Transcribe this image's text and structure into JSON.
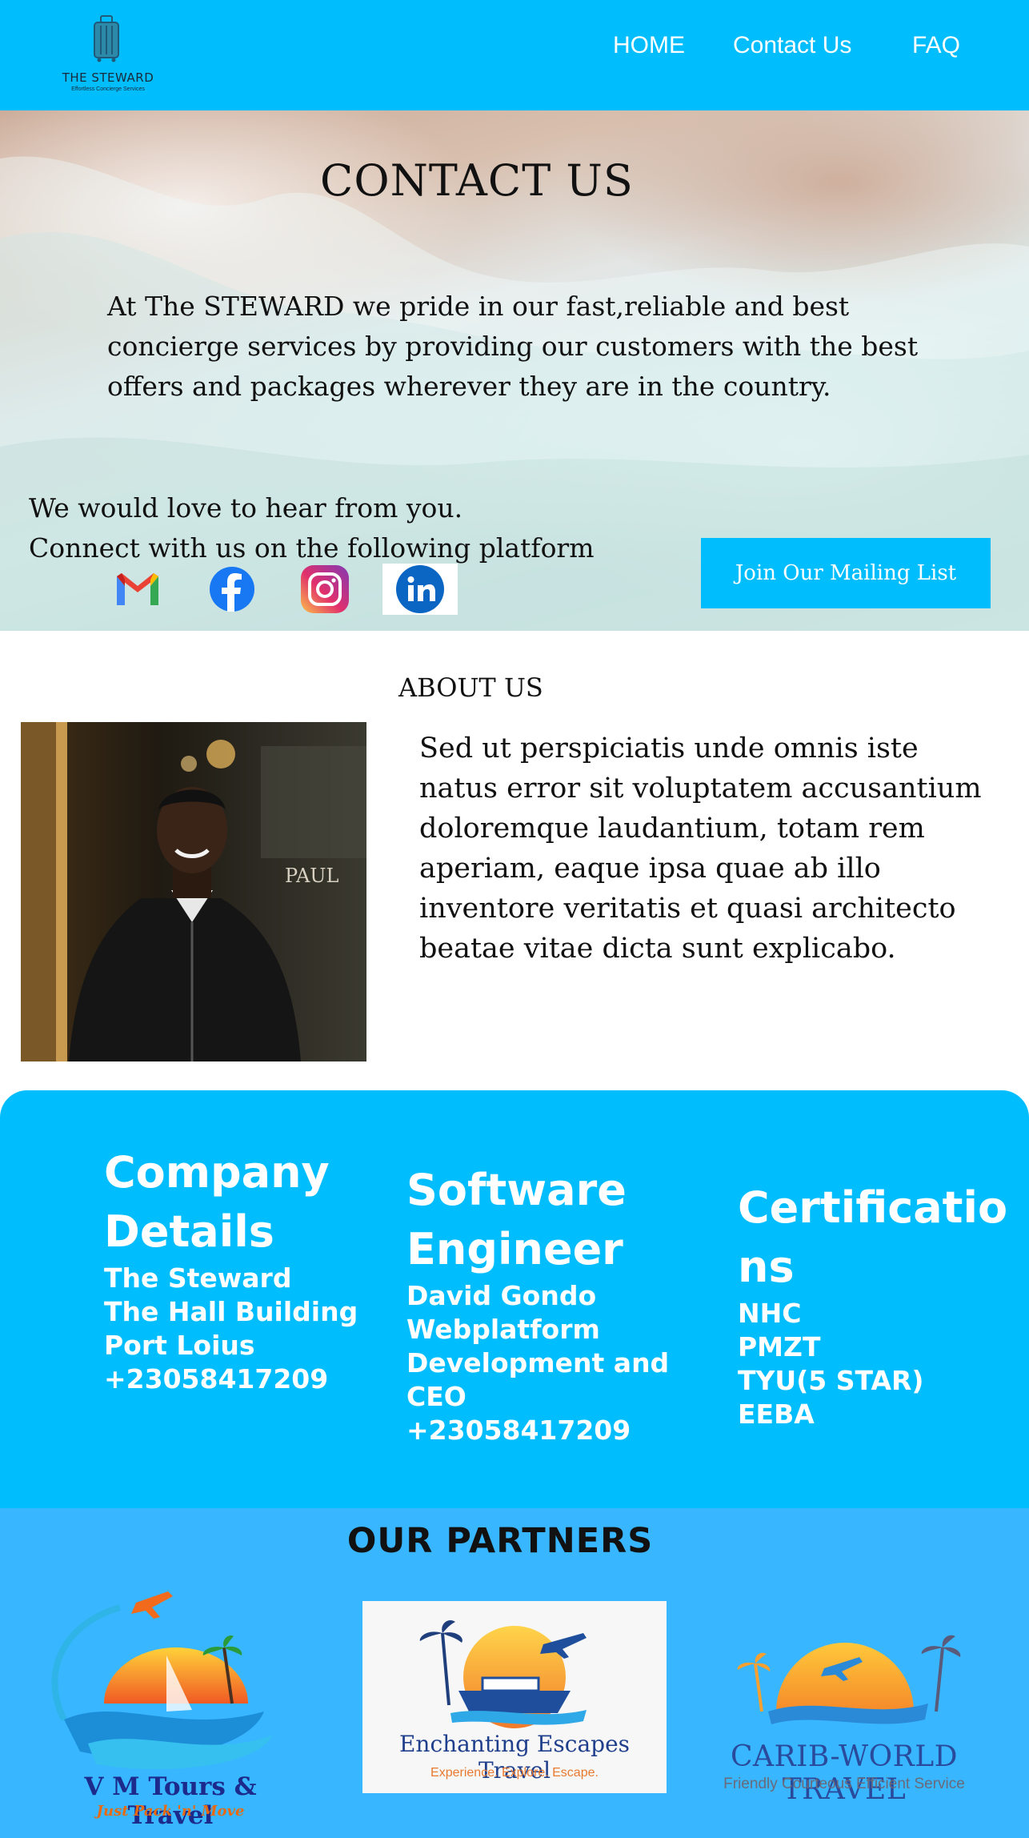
{
  "header": {
    "logo_title": "THE STEWARD",
    "logo_tagline": "Effortless Concierge Services",
    "nav": {
      "home": "HOME",
      "contact": "Contact Us",
      "faq": "FAQ"
    }
  },
  "hero": {
    "title": "CONTACT US",
    "paragraph": "At The STEWARD we pride in our fast,reliable and best concierge services by providing our customers with the best offers  and packages wherever they are in the country.",
    "hear_line": "We would love to hear from you.",
    "connect_line": "Connect with us on the following platform",
    "social_icons": [
      "gmail-icon",
      "facebook-icon",
      "instagram-icon",
      "linkedin-icon"
    ],
    "mailing_button": "Join Our Mailing List"
  },
  "about": {
    "title": "ABOUT US",
    "text": "Sed ut perspiciatis unde omnis iste natus error sit voluptatem accusantium doloremque laudantium, totam rem aperiam, eaque ipsa quae ab illo inventore veritatis et quasi architecto beatae vitae dicta sunt explicabo.",
    "photo_sign": "PAUL"
  },
  "details": {
    "company": {
      "heading": "Company Details",
      "lines": [
        "The Steward",
        "The Hall Building",
        "Port Loius",
        "+23058417209"
      ]
    },
    "engineer": {
      "heading": "Software Engineer",
      "lines": [
        "David Gondo",
        "Webplatform",
        "Development and",
        "CEO",
        "+23058417209"
      ]
    },
    "certifications": {
      "heading": "Certificatio ns",
      "lines": [
        "NHC",
        "PMZT",
        "TYU(5 STAR)",
        "EEBA"
      ]
    }
  },
  "partners": {
    "title": "OUR PARTNERS",
    "items": [
      {
        "name": "V M Tours & Travel",
        "tagline": "Just Pack 'n' Move"
      },
      {
        "name": "Enchanting Escapes Travel",
        "tagline": "Experience. Explore. Escape."
      },
      {
        "name": "CARIB-WORLD TRAVEL",
        "tagline": "Friendly  Courteous  Efficient Service"
      }
    ]
  },
  "colors": {
    "brand_blue": "#00bdfd",
    "partners_blue": "#38b6ff"
  }
}
